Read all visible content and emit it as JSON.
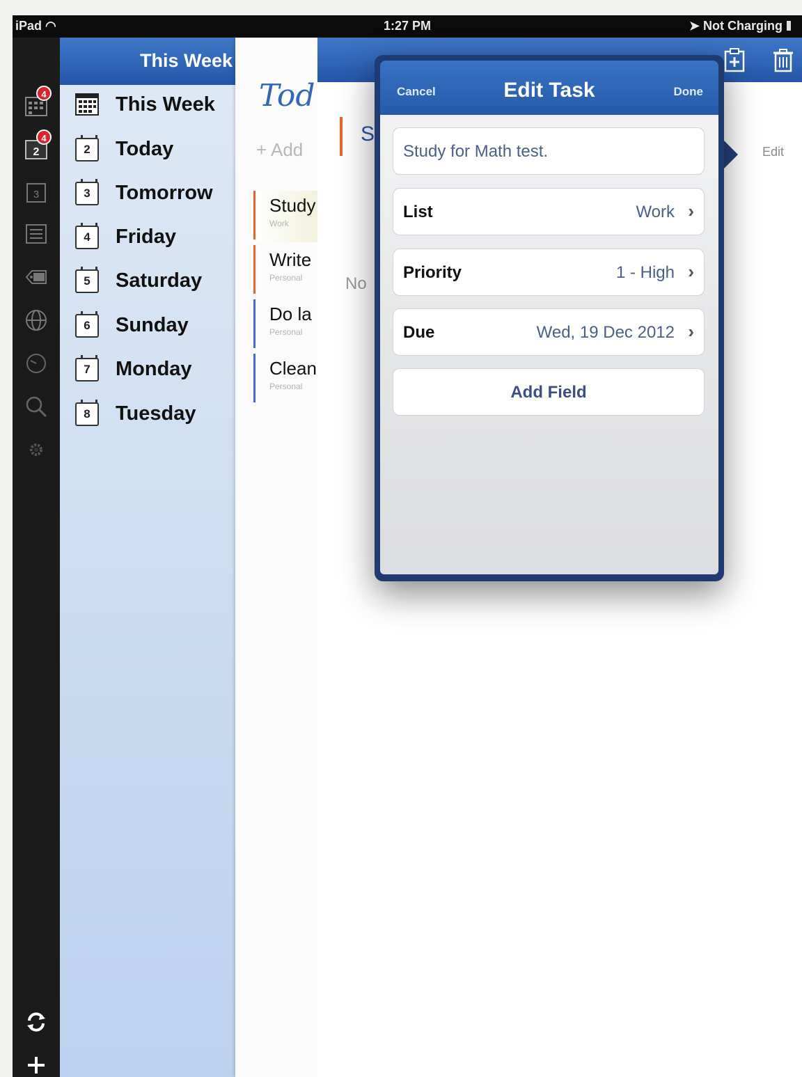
{
  "status_bar": {
    "device": "iPad",
    "time": "1:27 PM",
    "battery": "Not Charging"
  },
  "rail": {
    "icons": [
      "calendar-week-icon",
      "calendar-today-icon",
      "calendar-tomorrow-icon",
      "list-icon",
      "tag-icon",
      "globe-icon",
      "clock-icon",
      "search-icon",
      "gear-icon",
      "sync-icon",
      "add-icon"
    ],
    "badges": [
      "4",
      "4"
    ]
  },
  "list_panel": {
    "header": "This Week",
    "items": [
      {
        "label": "This Week",
        "day": ""
      },
      {
        "label": "Today",
        "day": "2"
      },
      {
        "label": "Tomorrow",
        "day": "3"
      },
      {
        "label": "Friday",
        "day": "4"
      },
      {
        "label": "Saturday",
        "day": "5"
      },
      {
        "label": "Sunday",
        "day": "6"
      },
      {
        "label": "Monday",
        "day": "7"
      },
      {
        "label": "Tuesday",
        "day": "8"
      }
    ]
  },
  "today_column": {
    "title": "Tod",
    "add_label": "+ Add",
    "tasks": [
      {
        "title": "Study",
        "list": "Work",
        "color": "#e6662a"
      },
      {
        "title": "Write",
        "list": "Personal",
        "color": "#e6662a"
      },
      {
        "title": "Do la",
        "list": "Personal",
        "color": "#3f6fc4"
      },
      {
        "title": "Clean",
        "list": "Personal",
        "color": "#3f6fc4"
      }
    ]
  },
  "detail": {
    "edit_label": "Edit",
    "notes_fragment": "No",
    "title_fragment": "S"
  },
  "edit_task": {
    "title": "Edit Task",
    "cancel": "Cancel",
    "done": "Done",
    "task_name": "Study for Math test.",
    "fields": [
      {
        "key": "List",
        "value": "Work"
      },
      {
        "key": "Priority",
        "value": "1 - High"
      },
      {
        "key": "Due",
        "value": "Wed, 19 Dec 2012"
      }
    ],
    "add_field": "Add Field"
  },
  "colors": {
    "accent_blue": "#2556a8",
    "badge_red": "#d9232d",
    "priority_orange": "#e6662a"
  }
}
